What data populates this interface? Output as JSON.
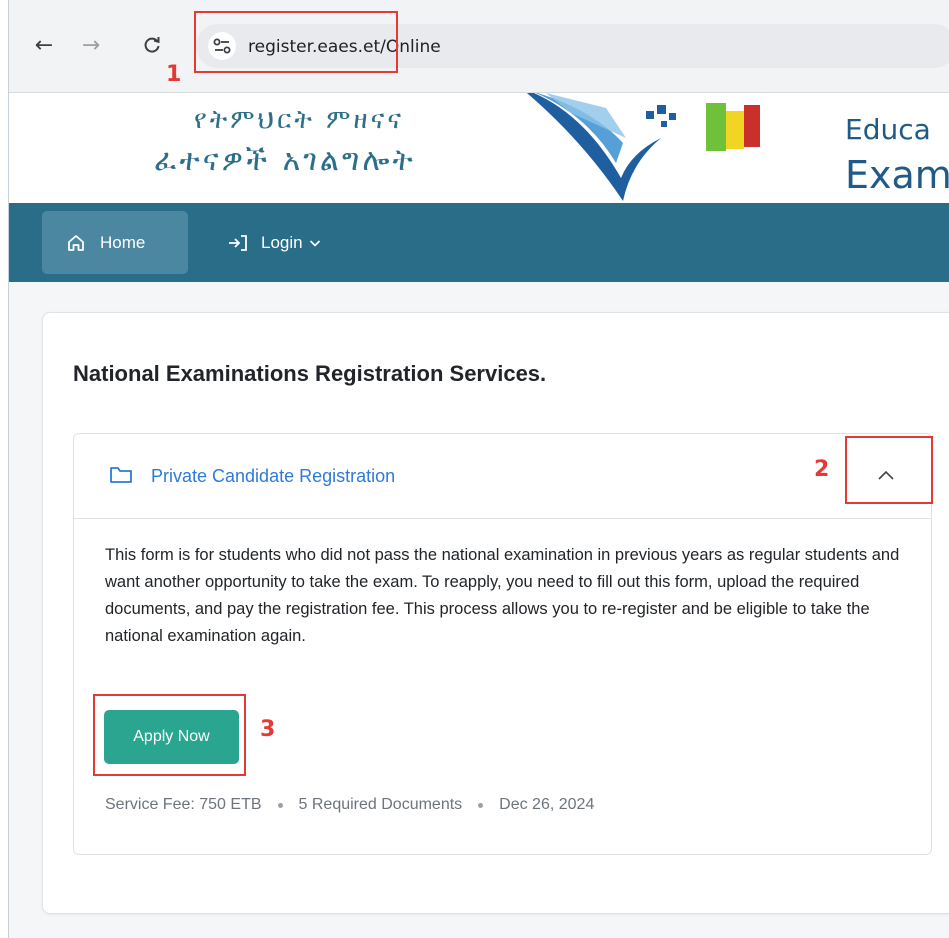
{
  "browser": {
    "back_icon": "arrow-left-icon",
    "forward_icon": "arrow-right-icon",
    "reload_icon": "reload-icon",
    "site_icon": "site-settings-icon",
    "url_domain": "register.eaes.et",
    "url_path": "/Online"
  },
  "header": {
    "amharic_line1": "የትምህርት ምዘናና",
    "amharic_line2": "ፈተናዎች አገልግሎት",
    "english_line1": "Educa",
    "english_line2": "Exam"
  },
  "nav": {
    "home_label": "Home",
    "login_label": "Login"
  },
  "main": {
    "title": "National Examinations Registration Services.",
    "accordion": {
      "title": "Private Candidate Registration",
      "description": "This form is for students who did not pass the national examination in previous years as regular students and want another opportunity to take the exam. To reapply, you need to fill out this form, upload the required documents, and pay the registration fee. This process allows you to re-register and be eligible to take the national examination again.",
      "apply_label": "Apply Now",
      "fee": "Service Fee: 750 ETB",
      "documents": "5 Required Documents",
      "date": "Dec 26, 2024"
    }
  },
  "annotations": {
    "n1": "1",
    "n2": "2",
    "n3": "3",
    "color": "#e53935"
  },
  "colors": {
    "navbar": "#2a6d89",
    "accent_link": "#2f7ad8",
    "apply_button": "#2aa690"
  }
}
